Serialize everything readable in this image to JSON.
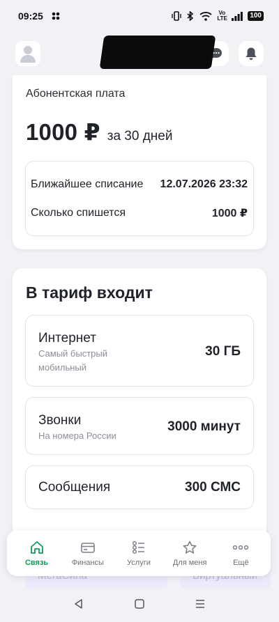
{
  "status": {
    "time": "09:25",
    "battery": "100",
    "volte": "Vo LTE"
  },
  "header": {
    "avatar_icon": "user-avatar-icon",
    "chat_icon": "chat-bubble-icon",
    "bell_icon": "bell-icon"
  },
  "fee": {
    "label": "Абонентская плата",
    "amount": "1000 ₽",
    "period": "за 30 дней",
    "next_charge_label": "Ближайшее списание",
    "next_charge_date": "12.07.2026 23:32",
    "charge_amount_label": "Сколько спишется",
    "charge_amount": "1000 ₽"
  },
  "tariff": {
    "title": "В тариф входит",
    "items": [
      {
        "title": "Интернет",
        "subtitle": "Самый быстрый мобильный",
        "value": "30 ГБ"
      },
      {
        "title": "Звонки",
        "subtitle": "На номера России",
        "value": "3000 минут"
      },
      {
        "title": "Сообщения",
        "subtitle": "",
        "value": "300 СМС"
      }
    ]
  },
  "peek": {
    "left": "МегаСила",
    "right": "Виртуальный"
  },
  "nav": {
    "items": [
      {
        "label": "Связь",
        "icon": "home-icon",
        "active": true
      },
      {
        "label": "Финансы",
        "icon": "card-icon",
        "active": false
      },
      {
        "label": "Услуги",
        "icon": "list-icon",
        "active": false
      },
      {
        "label": "Для меня",
        "icon": "star-icon",
        "active": false
      },
      {
        "label": "Ещё",
        "icon": "more-icon",
        "active": false
      }
    ]
  },
  "colors": {
    "accent": "#0f9d58",
    "background": "#f1f2f5",
    "muted": "#8b8f98"
  }
}
